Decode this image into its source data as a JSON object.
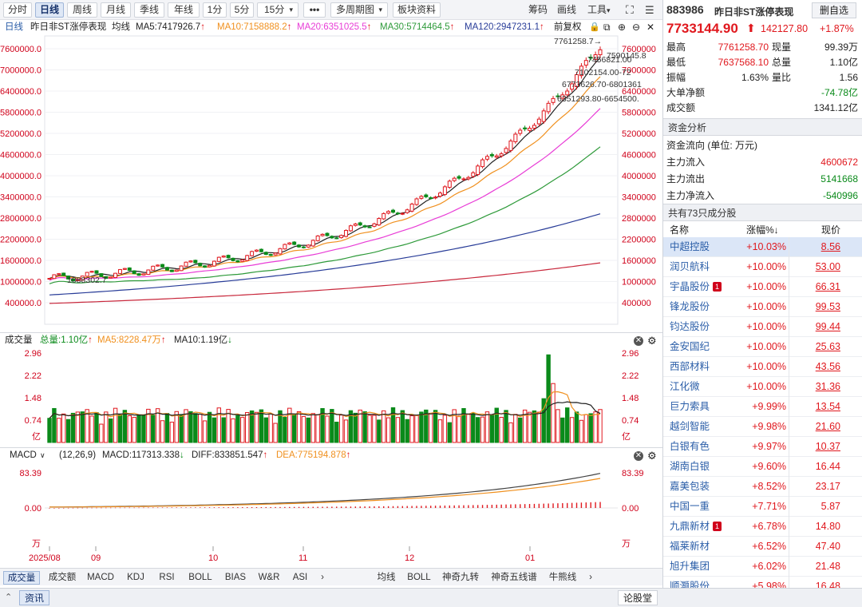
{
  "toolbar": {
    "tabs": [
      "分时",
      "日线",
      "周线",
      "月线",
      "季线",
      "年线",
      "1分",
      "5分",
      "15分"
    ],
    "more": "•••",
    "multi_period": "多周期图",
    "sector_data": "板块资料",
    "right_items": [
      "筹码",
      "画线",
      "工具"
    ],
    "active_tab": "日线"
  },
  "ma_line": {
    "type": "日线",
    "name": "昨日非ST涨停表现",
    "kind": "均线",
    "ma5": "MA5:7417926.7",
    "ma10": "MA10:7158888.2",
    "ma20": "MA20:6351025.5",
    "ma30": "MA30:5714464.5",
    "ma120": "MA120:2947231.1",
    "adjust": "前复权",
    "arrow": "↑"
  },
  "colors": {
    "up": "#e0181e",
    "down": "#0a8a1a",
    "ma5": "#222222",
    "ma10": "#f0901e",
    "ma20": "#e83cd6",
    "ma30": "#2e9a3a",
    "ma60": "#283c98",
    "ma120": "#c8283c",
    "accent": "#2b5ea8"
  },
  "price_pane": {
    "left_ticks": [
      "7600000.0",
      "7000000.0",
      "6400000.0",
      "5800000.0",
      "5200000.0",
      "4600000.0",
      "4000000.0",
      "3400000.0",
      "2800000.0",
      "2200000.0",
      "1600000.0",
      "1000000.0",
      "400000.0"
    ],
    "right_ticks": [
      "7600000",
      "7000000",
      "6400000",
      "5800000",
      "5200000",
      "4600000",
      "4000000",
      "3400000",
      "2800000",
      "2200000",
      "1600000",
      "1000000",
      "400000"
    ],
    "annotations": {
      "high_label": "7761258.7→",
      "low_label": "1088302.7",
      "a1": "7590145.8",
      "a2": "7456821.00",
      "a3": "7102154.00-72",
      "a4": "6773626.70-6801361",
      "a5": "6351293.80-6654500."
    }
  },
  "volume_pane": {
    "title": "成交量",
    "total": "总量:1.10亿",
    "ma5": "MA5:8228.47万",
    "ma10": "MA10:1.19亿",
    "ticks": [
      "2.96",
      "2.22",
      "1.48",
      "0.74"
    ],
    "unit": "亿"
  },
  "macd_pane": {
    "title": "MACD",
    "params": "(12,26,9)",
    "macd": "MACD:117313.338",
    "diff": "DIFF:833851.547",
    "dea": "DEA:775194.878",
    "ticks": [
      "83.39",
      "0.00"
    ],
    "unit": "万"
  },
  "x_axis": [
    "2025/08",
    "09",
    "10",
    "11",
    "12",
    "01"
  ],
  "bottom_tabs": {
    "left": [
      "成交量",
      "成交额",
      "MACD",
      "KDJ",
      "RSI",
      "BOLL",
      "BIAS",
      "W&R",
      "ASI"
    ],
    "right": [
      "均线",
      "BOLL",
      "神奇九转",
      "神奇五线谱",
      "牛熊线"
    ],
    "active": "成交量"
  },
  "status": {
    "info": "资讯",
    "forum": "论股堂"
  },
  "quote": {
    "code": "883986",
    "name": "昨日非ST涨停表现",
    "add_button": "删自选",
    "price": "7733144.90",
    "change": "142127.80",
    "change_pct": "+1.87%",
    "stats": [
      {
        "k1": "最高",
        "v1": "7761258.70",
        "k2": "现量",
        "v2": "99.39万"
      },
      {
        "k1": "最低",
        "v1": "7637568.10",
        "k2": "总量",
        "v2": "1.10亿"
      },
      {
        "k1": "振幅",
        "v1": "1.63%",
        "k2": "量比",
        "v2": "1.56"
      }
    ],
    "big_net": {
      "k": "大单净额",
      "v": "-74.78亿"
    },
    "turnover": {
      "k": "成交额",
      "v": "1341.12亿"
    }
  },
  "fund_flow": {
    "title": "资金分析",
    "subtitle": "资金流向 (单位: 万元)",
    "rows": [
      {
        "k": "主力流入",
        "v": "4600672"
      },
      {
        "k": "主力流出",
        "v": "5141668"
      },
      {
        "k": "主力净流入",
        "v": "-540996"
      }
    ]
  },
  "constituents": {
    "title": "共有73只成分股",
    "headers": [
      "名称",
      "涨幅%↓",
      "现价"
    ],
    "rows": [
      {
        "name": "中超控股",
        "pct": "+10.03%",
        "price": "8.56",
        "u": true,
        "badge": false
      },
      {
        "name": "润贝航科",
        "pct": "+10.00%",
        "price": "53.00",
        "u": true,
        "badge": false
      },
      {
        "name": "宇晶股份",
        "pct": "+10.00%",
        "price": "66.31",
        "u": true,
        "badge": true
      },
      {
        "name": "锋龙股份",
        "pct": "+10.00%",
        "price": "99.53",
        "u": true,
        "badge": false
      },
      {
        "name": "钧达股份",
        "pct": "+10.00%",
        "price": "99.44",
        "u": true,
        "badge": false
      },
      {
        "name": "金安国纪",
        "pct": "+10.00%",
        "price": "25.63",
        "u": true,
        "badge": false
      },
      {
        "name": "西部材料",
        "pct": "+10.00%",
        "price": "43.56",
        "u": true,
        "badge": false
      },
      {
        "name": "江化微",
        "pct": "+10.00%",
        "price": "31.36",
        "u": true,
        "badge": false
      },
      {
        "name": "巨力索具",
        "pct": "+9.99%",
        "price": "13.54",
        "u": true,
        "badge": false
      },
      {
        "name": "越剑智能",
        "pct": "+9.98%",
        "price": "21.60",
        "u": true,
        "badge": false
      },
      {
        "name": "白银有色",
        "pct": "+9.97%",
        "price": "10.37",
        "u": true,
        "badge": false
      },
      {
        "name": "湖南白银",
        "pct": "+9.60%",
        "price": "16.44",
        "u": false,
        "badge": false
      },
      {
        "name": "嘉美包装",
        "pct": "+8.52%",
        "price": "23.17",
        "u": false,
        "badge": false
      },
      {
        "name": "中国一重",
        "pct": "+7.71%",
        "price": "5.87",
        "u": false,
        "badge": false
      },
      {
        "name": "九鼎新材",
        "pct": "+6.78%",
        "price": "14.80",
        "u": false,
        "badge": true
      },
      {
        "name": "福莱新材",
        "pct": "+6.52%",
        "price": "47.40",
        "u": false,
        "badge": false
      },
      {
        "name": "旭升集团",
        "pct": "+6.02%",
        "price": "21.48",
        "u": false,
        "badge": false
      },
      {
        "name": "顺灏股份",
        "pct": "+5.98%",
        "price": "16.48",
        "u": false,
        "badge": false
      }
    ]
  }
}
